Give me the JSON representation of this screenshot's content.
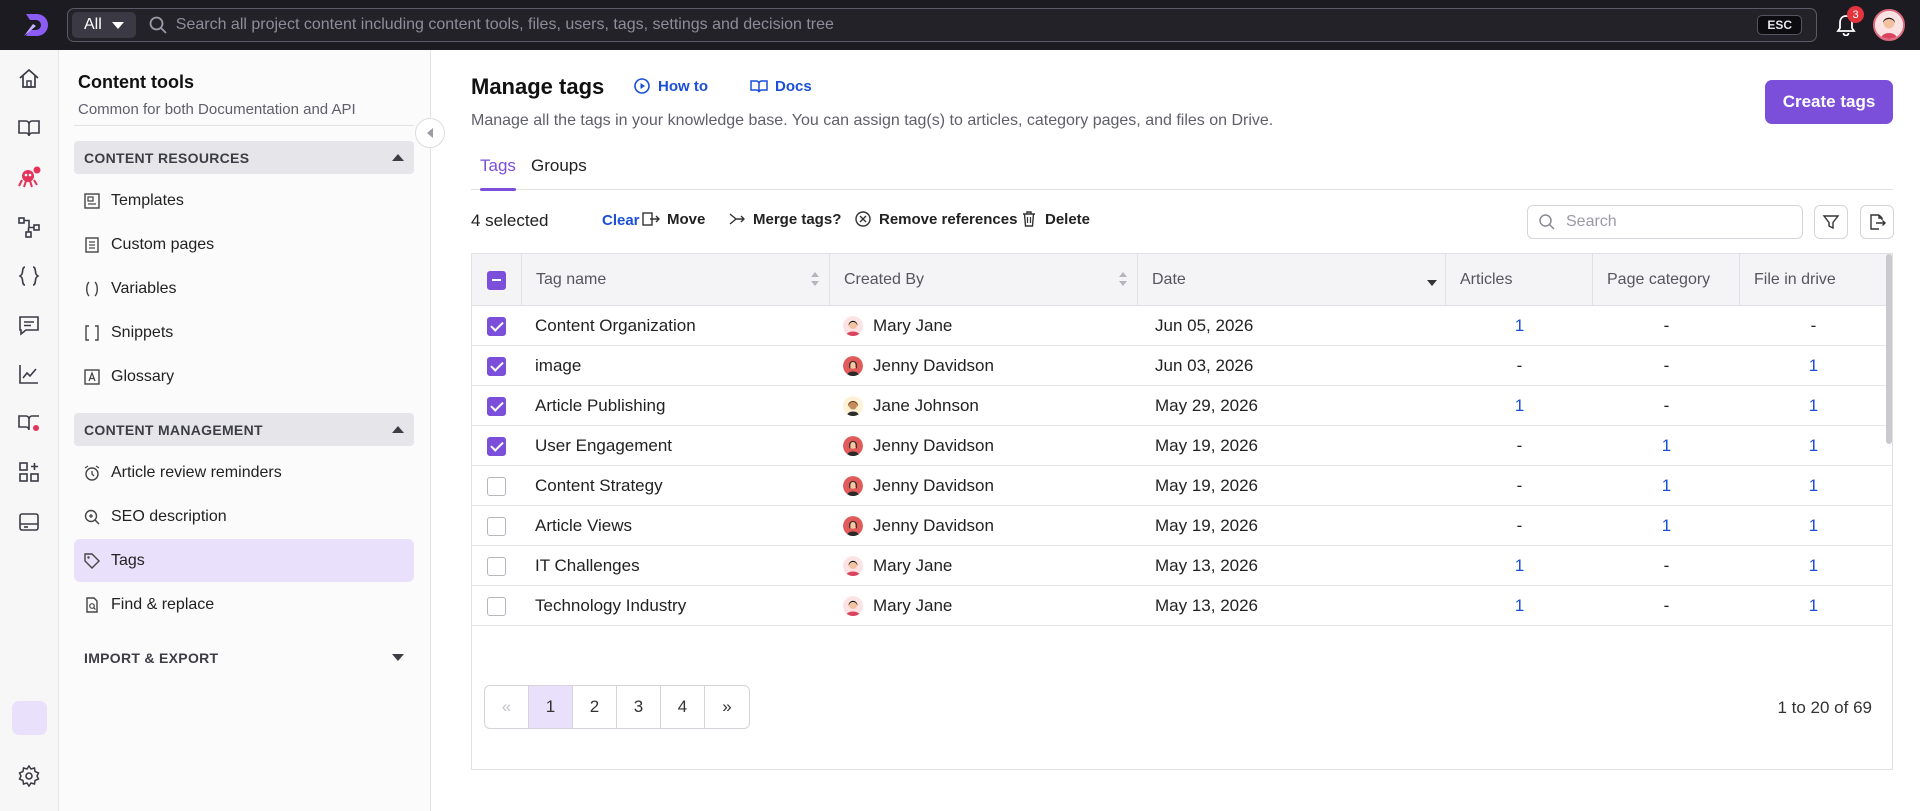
{
  "topbar": {
    "scope": "All",
    "search_placeholder": "Search all project content including content tools, files, users, tags, settings and decision tree",
    "esc_label": "ESC",
    "notification_count": "3"
  },
  "rail": {
    "icons": [
      "home-icon",
      "book-icon",
      "bot-icon",
      "workflow-icon",
      "code-braces-icon",
      "chat-icon",
      "analytics-icon",
      "knowledge-base-icon",
      "apps-icon",
      "drive-icon",
      "active-placeholder",
      "settings-icon"
    ]
  },
  "panel": {
    "title": "Content tools",
    "subtitle": "Common for both Documentation and API",
    "sections": [
      {
        "heading": "CONTENT RESOURCES",
        "items": [
          {
            "label": "Templates",
            "icon": "template-icon"
          },
          {
            "label": "Custom pages",
            "icon": "page-icon"
          },
          {
            "label": "Variables",
            "icon": "variable-icon"
          },
          {
            "label": "Snippets",
            "icon": "snippet-icon"
          },
          {
            "label": "Glossary",
            "icon": "glossary-icon"
          }
        ]
      },
      {
        "heading": "CONTENT MANAGEMENT",
        "items": [
          {
            "label": "Article review reminders",
            "icon": "alarm-icon"
          },
          {
            "label": "SEO description",
            "icon": "seo-icon"
          },
          {
            "label": "Tags",
            "icon": "tag-icon",
            "active": true
          },
          {
            "label": "Find & replace",
            "icon": "find-replace-icon"
          }
        ]
      },
      {
        "heading": "IMPORT & EXPORT",
        "items": []
      }
    ]
  },
  "main": {
    "title": "Manage tags",
    "how_to": "How to",
    "docs": "Docs",
    "description": "Manage all the tags in your knowledge base. You can assign tag(s) to articles, category pages, and files on Drive.",
    "create_button": "Create tags",
    "tabs": [
      "Tags",
      "Groups"
    ],
    "active_tab": "Tags",
    "toolbar": {
      "selected": "4 selected",
      "clear": "Clear",
      "move": "Move",
      "merge": "Merge tags?",
      "remove_refs": "Remove references",
      "delete": "Delete",
      "search_placeholder": "Search"
    },
    "table": {
      "columns": [
        "Tag name",
        "Created By",
        "Date",
        "Articles",
        "Page category",
        "File in drive"
      ],
      "rows": [
        {
          "checked": true,
          "tag": "Content Organization",
          "created_by": "Mary Jane",
          "avatar": "mary",
          "date": "Jun 05, 2026",
          "articles": "1",
          "page_category": "-",
          "file_in_drive": "-"
        },
        {
          "checked": true,
          "tag": "image",
          "created_by": "Jenny Davidson",
          "avatar": "jenny",
          "date": "Jun 03, 2026",
          "articles": "-",
          "page_category": "-",
          "file_in_drive": "1"
        },
        {
          "checked": true,
          "tag": "Article Publishing",
          "created_by": "Jane Johnson",
          "avatar": "jane",
          "date": "May 29, 2026",
          "articles": "1",
          "page_category": "-",
          "file_in_drive": "1"
        },
        {
          "checked": true,
          "tag": "User Engagement",
          "created_by": "Jenny Davidson",
          "avatar": "jenny",
          "date": "May 19, 2026",
          "articles": "-",
          "page_category": "1",
          "file_in_drive": "1"
        },
        {
          "checked": false,
          "tag": "Content Strategy",
          "created_by": "Jenny Davidson",
          "avatar": "jenny",
          "date": "May 19, 2026",
          "articles": "-",
          "page_category": "1",
          "file_in_drive": "1"
        },
        {
          "checked": false,
          "tag": "Article Views",
          "created_by": "Jenny Davidson",
          "avatar": "jenny",
          "date": "May 19, 2026",
          "articles": "-",
          "page_category": "1",
          "file_in_drive": "1"
        },
        {
          "checked": false,
          "tag": "IT Challenges",
          "created_by": "Mary Jane",
          "avatar": "mary",
          "date": "May 13, 2026",
          "articles": "1",
          "page_category": "-",
          "file_in_drive": "1"
        },
        {
          "checked": false,
          "tag": "Technology Industry",
          "created_by": "Mary Jane",
          "avatar": "mary",
          "date": "May 13, 2026",
          "articles": "1",
          "page_category": "-",
          "file_in_drive": "1"
        }
      ]
    },
    "pagination": {
      "first": "«",
      "pages": [
        "1",
        "2",
        "3",
        "4"
      ],
      "current": "1",
      "last": "»",
      "summary": "1 to 20 of 69"
    }
  },
  "colors": {
    "accent": "#7b4fd9",
    "link": "#1a4fd6",
    "topbar": "#1c1b22",
    "active_bg": "#e9e1fb"
  }
}
